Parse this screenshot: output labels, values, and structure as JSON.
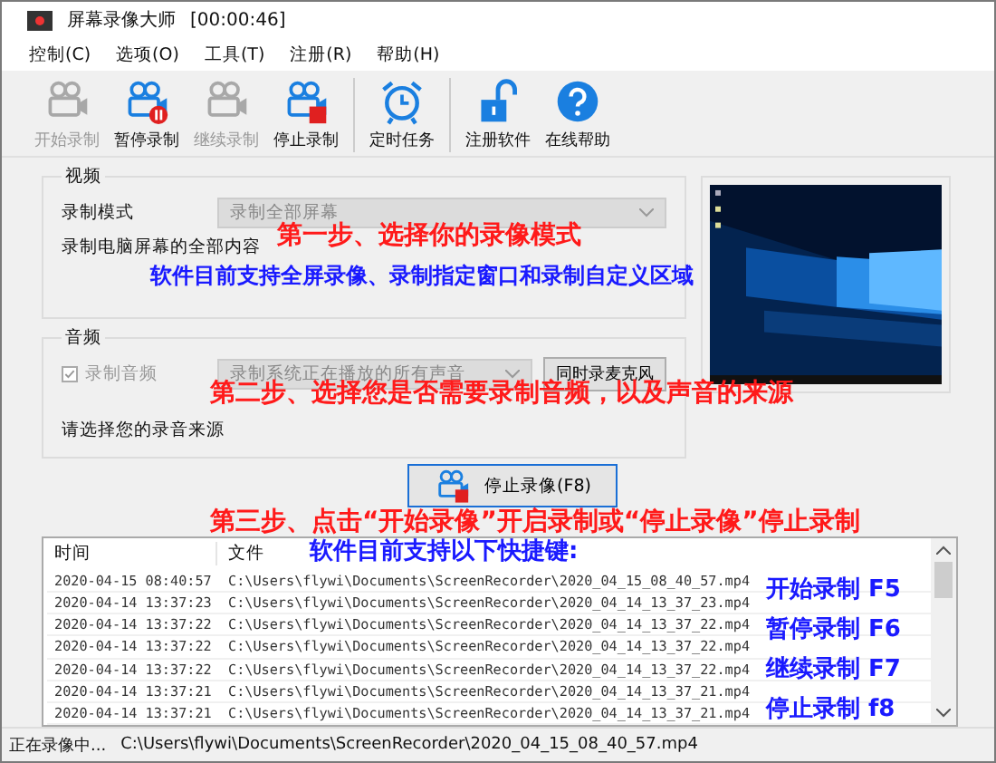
{
  "window": {
    "title": "屏幕录像大师",
    "timer": "[00:00:46]"
  },
  "menu": [
    "控制(C)",
    "选项(O)",
    "工具(T)",
    "注册(R)",
    "帮助(H)"
  ],
  "toolbar": [
    {
      "label": "开始录制",
      "kind": "camera",
      "separator_before": false,
      "disabled": true
    },
    {
      "label": "暂停录制",
      "kind": "camera-pause",
      "separator_before": false,
      "disabled": false
    },
    {
      "label": "继续录制",
      "kind": "camera-resume",
      "separator_before": false,
      "disabled": true
    },
    {
      "label": "停止录制",
      "kind": "camera-stop",
      "separator_before": false,
      "disabled": false
    },
    {
      "label": "定时任务",
      "kind": "alarm",
      "separator_before": true,
      "disabled": false
    },
    {
      "label": "注册软件",
      "kind": "lock",
      "separator_before": true,
      "disabled": false
    },
    {
      "label": "在线帮助",
      "kind": "help",
      "separator_before": false,
      "disabled": false
    }
  ],
  "video": {
    "title": "视频",
    "mode_label": "录制模式",
    "mode_value": "录制全部屏幕",
    "mode_disabled": true,
    "description": "录制电脑屏幕的全部内容"
  },
  "audio": {
    "title": "音频",
    "record_label": "录制音频",
    "record_checked": true,
    "record_disabled": true,
    "source_value": "录制系统正在播放的所有声音",
    "mic_button": "同时录麦克风",
    "hint": "请选择您的录音来源"
  },
  "stop_button": "停止录像(F8)",
  "log": {
    "columns": [
      "时间",
      "文件"
    ],
    "rows": [
      [
        "2020-04-15 08:40:57",
        "C:\\Users\\flywi\\Documents\\ScreenRecorder\\2020_04_15_08_40_57.mp4"
      ],
      [
        "2020-04-14 13:37:23",
        "C:\\Users\\flywi\\Documents\\ScreenRecorder\\2020_04_14_13_37_23.mp4"
      ],
      [
        "2020-04-14 13:37:22",
        "C:\\Users\\flywi\\Documents\\ScreenRecorder\\2020_04_14_13_37_22.mp4"
      ],
      [
        "2020-04-14 13:37:22",
        "C:\\Users\\flywi\\Documents\\ScreenRecorder\\2020_04_14_13_37_22.mp4"
      ],
      [
        "2020-04-14 13:37:22",
        "C:\\Users\\flywi\\Documents\\ScreenRecorder\\2020_04_14_13_37_22.mp4"
      ],
      [
        "2020-04-14 13:37:21",
        "C:\\Users\\flywi\\Documents\\ScreenRecorder\\2020_04_14_13_37_21.mp4"
      ],
      [
        "2020-04-14 13:37:21",
        "C:\\Users\\flywi\\Documents\\ScreenRecorder\\2020_04_14_13_37_21.mp4"
      ]
    ]
  },
  "status_bar": {
    "state": "正在录像中...",
    "path": "C:\\Users\\flywi\\Documents\\ScreenRecorder\\2020_04_15_08_40_57.mp4"
  },
  "annotations": [
    {
      "text": "第一步、选择你的录像模式",
      "color": "#ff1a1a"
    },
    {
      "text": "软件目前支持全屏录像、录制指定窗口和录制自定义区域",
      "color": "#1a1aff"
    },
    {
      "text": "第二步、选择您是否需要录制音频，以及声音的来源",
      "color": "#ff1a1a"
    },
    {
      "text": "第三步、点击“开始录像”开启录制或“停止录像”停止录制",
      "color": "#ff1a1a"
    },
    {
      "text": "软件目前支持以下快捷键:",
      "color": "#1a1aff"
    },
    {
      "text": "开始录制 F5",
      "color": "#1a1aff"
    },
    {
      "text": "暂停录制 F6",
      "color": "#1a1aff"
    },
    {
      "text": "继续录制 F7",
      "color": "#1a1aff"
    },
    {
      "text": "停止录制 f8",
      "color": "#1a1aff"
    }
  ]
}
